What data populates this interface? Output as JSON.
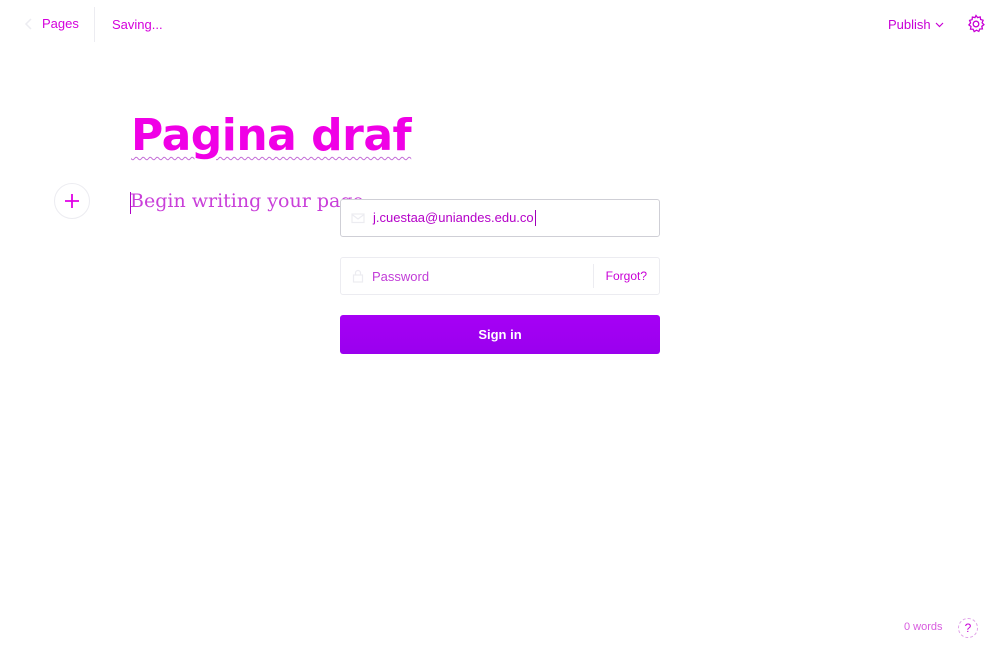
{
  "header": {
    "back_label": "Pages",
    "status": "Saving...",
    "publish_label": "Publish"
  },
  "editor": {
    "title": "Pagina draf",
    "body_placeholder": "Begin writing your page..."
  },
  "signin": {
    "email_value": "j.cuestaa@uniandes.edu.co",
    "password_placeholder": "Password",
    "forgot_label": "Forgot?",
    "button_label": "Sign in"
  },
  "footer": {
    "word_count": "0 words",
    "help_label": "?"
  },
  "icons": {
    "back": "chevron-left-icon",
    "publish": "chevron-down-icon",
    "settings": "gear-icon",
    "add": "plus-icon",
    "email": "mail-icon",
    "password": "lock-icon"
  },
  "colors": {
    "accent": "#e000e6",
    "button": "#a000f2"
  }
}
